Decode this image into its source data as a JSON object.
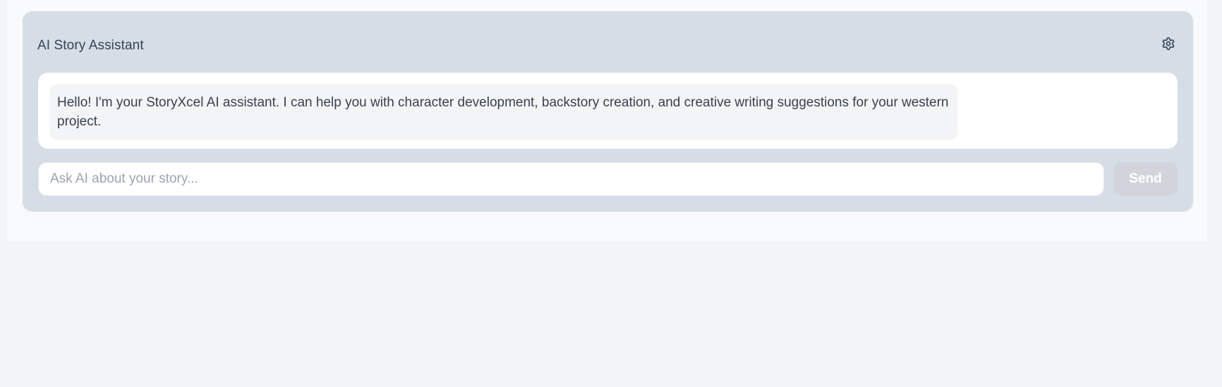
{
  "assistant": {
    "title": "AI Story Assistant",
    "settings_icon": "gear-icon",
    "messages": [
      {
        "role": "assistant",
        "text": "Hello! I'm your StoryXcel AI assistant. I can help you with character development, backstory creation, and creative writing suggestions for your western project."
      }
    ],
    "input": {
      "value": "",
      "placeholder": "Ask AI about your story..."
    },
    "send_label": "Send"
  },
  "colors": {
    "page_background": "#f3f4f6",
    "panel_background": "#d5dee6",
    "bubble_background": "#f3f4f6",
    "text": "#374151",
    "placeholder": "#9ca3af",
    "send_disabled": "#d1d5db"
  }
}
